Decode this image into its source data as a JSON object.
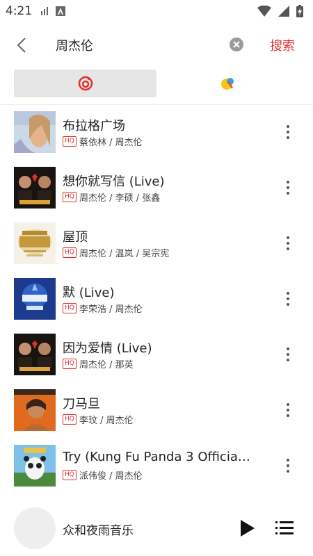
{
  "status_bar": {
    "time": "4:21"
  },
  "search": {
    "query": "周杰伦",
    "search_label": "搜索"
  },
  "songs": [
    {
      "title": "布拉格广场",
      "quality": "HQ",
      "artists": "蔡依林 / 周杰伦"
    },
    {
      "title": "想你就写信 (Live)",
      "quality": "HQ",
      "artists": "周杰伦 / 李硕 / 张鑫"
    },
    {
      "title": "屋顶",
      "quality": "HQ",
      "artists": "周杰伦 / 温岚 / 吴宗宪"
    },
    {
      "title": "默 (Live)",
      "quality": "HQ",
      "artists": "李荣浩 / 周杰伦"
    },
    {
      "title": "因为爱情 (Live)",
      "quality": "HQ",
      "artists": "周杰伦 / 那英"
    },
    {
      "title": "刀马旦",
      "quality": "HQ",
      "artists": "李玟 / 周杰伦"
    },
    {
      "title": "Try (Kung Fu Panda 3 Official T...",
      "quality": "HQ",
      "artists": "派伟俊 / 周杰伦"
    }
  ],
  "player": {
    "title": "众和夜雨音乐"
  },
  "colors": {
    "accent": "#e02f2f",
    "netease_red": "#e02f2f",
    "tab_selected_bg": "#e6e6e6"
  },
  "icons": {
    "back": "back-arrow-icon",
    "clear": "clear-icon",
    "netease": "netease-music-icon",
    "kuwo": "kuwo-music-icon",
    "more": "more-vert-icon",
    "play": "play-icon",
    "playlist": "playlist-icon"
  }
}
